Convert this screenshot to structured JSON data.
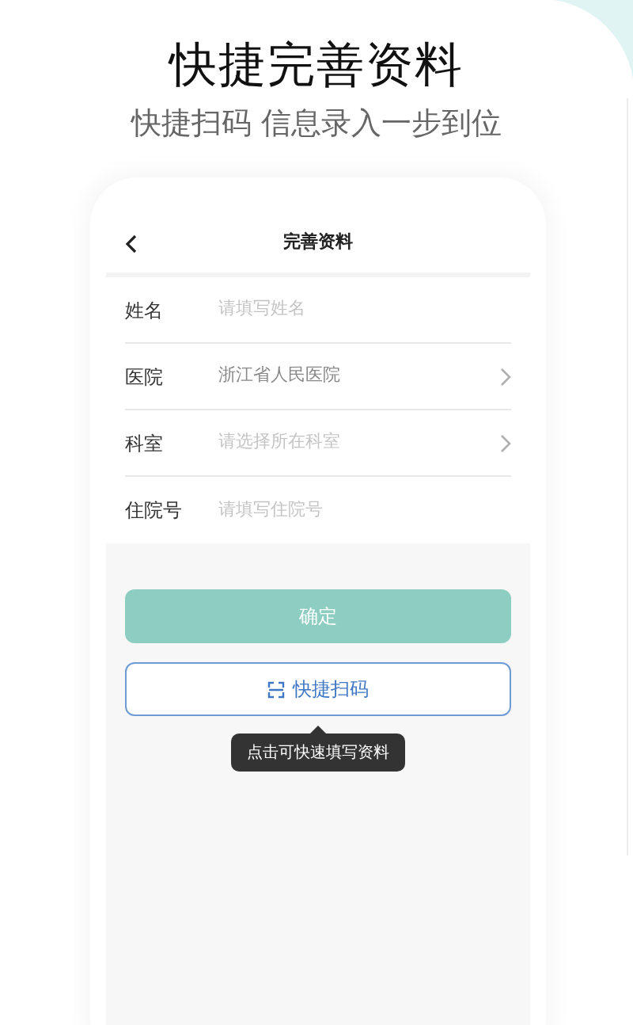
{
  "title": "快捷完善资料",
  "subtitle": "快捷扫码 信息录入一步到位",
  "screen": {
    "title": "完善资料",
    "fields": [
      {
        "label": "姓名",
        "kind": "input",
        "placeholder": "请填写姓名"
      },
      {
        "label": "医院",
        "kind": "select",
        "value": "浙江省人民医院"
      },
      {
        "label": "科室",
        "kind": "select",
        "placeholder": "请选择所在科室"
      },
      {
        "label": "住院号",
        "kind": "input",
        "placeholder": "请填写住院号"
      }
    ],
    "confirm_button": "确定",
    "scan_button": "快捷扫码",
    "tooltip": "点击可快速填写资料"
  }
}
